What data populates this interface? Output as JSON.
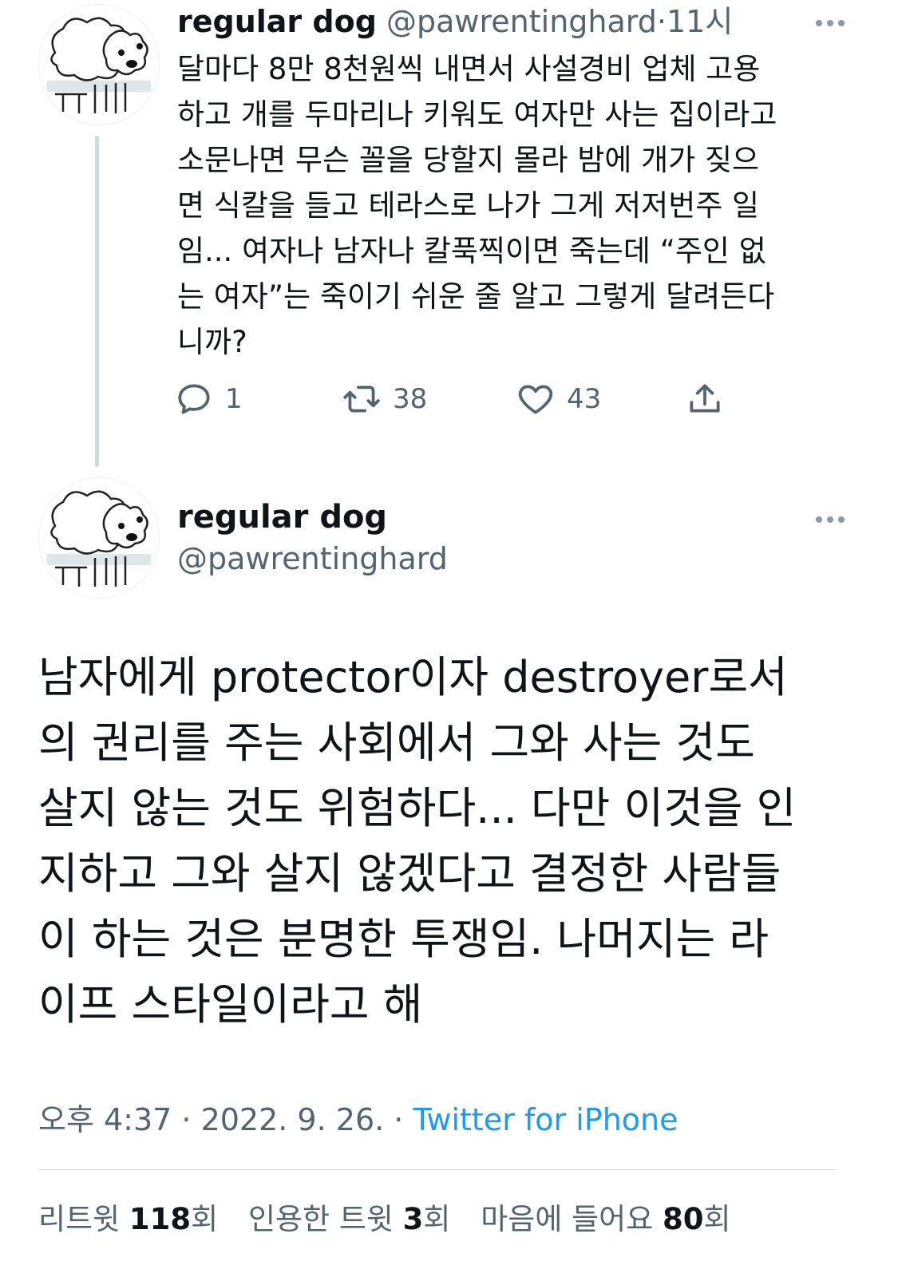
{
  "parent_tweet": {
    "author_name": "regular dog",
    "handle": "@pawrentinghard",
    "separator": "·",
    "time": "11시",
    "text_lines": [
      "달마다 8만 8천원씩 내면서 사설경비 업체 고용",
      "하고 개를 두마리나 키워도 여자만 사는 집이라고",
      "소문나면 무슨 꼴을 당할지 몰라 밤에 개가 짖으",
      "면 식칼을 들고 테라스로 나가 그게 저저번주 일",
      "임... 여자나 남자나 칼푹찍이면 죽는데 “주인 없",
      "는 여자”는 죽이기 쉬운 줄 알고 그렇게 달려든다",
      "니까?"
    ],
    "actions": {
      "reply_count": "1",
      "retweet_count": "38",
      "like_count": "43"
    },
    "icons": [
      "reply-icon",
      "retweet-icon",
      "like-icon",
      "share-icon",
      "more-icon"
    ]
  },
  "main_tweet": {
    "author_name": "regular dog",
    "handle": "@pawrentinghard",
    "text_lines": [
      "남자에게 protector이자 destroyer로서",
      "의 권리를 주는 사회에서 그와 사는 것도",
      "살지 않는 것도 위험하다... 다만 이것을 인",
      "지하고 그와 살지 않겠다고 결정한 사람들",
      "이 하는 것은 분명한 투쟁임. 나머지는 라",
      "이프 스타일이라고 해"
    ],
    "timestamp": "오후 4:37 · 2022. 9. 26. ·",
    "source": "Twitter for iPhone",
    "stats": {
      "retweets_label": "리트윗",
      "retweets_count": "118",
      "retweets_suffix": "회",
      "quotes_label": "인용한 트윗",
      "quotes_count": "3",
      "quotes_suffix": "회",
      "likes_label": "마음에 들어요",
      "likes_count": "80",
      "likes_suffix": "회"
    }
  },
  "colors": {
    "text": "#0f1419",
    "secondary": "#536471",
    "accent": "#1d9bf0",
    "border": "#cfd9de"
  }
}
